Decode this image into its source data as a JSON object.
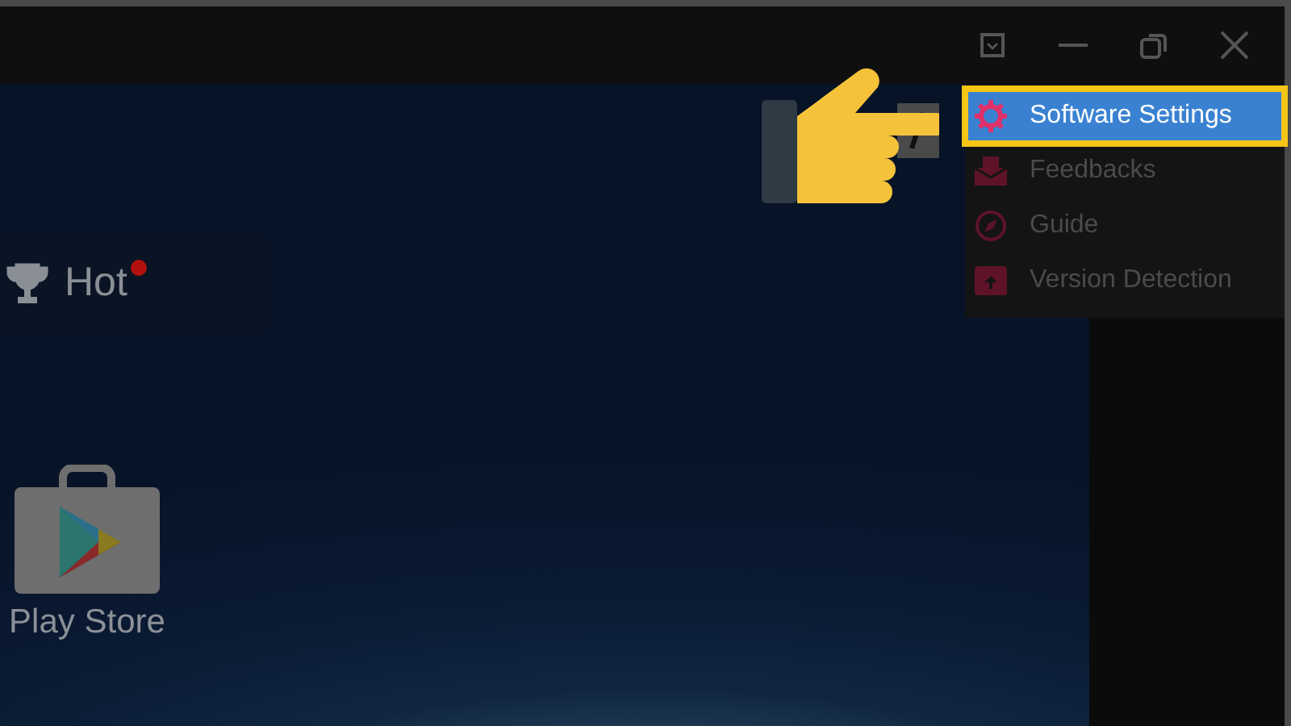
{
  "home_screen": {
    "hot_tab": {
      "label": "Hot",
      "notification": true
    },
    "apps": [
      {
        "label": "Play Store"
      }
    ]
  },
  "menu": {
    "items": [
      {
        "label": "Software Settings",
        "selected": true
      },
      {
        "label": "Feedbacks",
        "selected": false
      },
      {
        "label": "Guide",
        "selected": false
      },
      {
        "label": "Version Detection",
        "selected": false
      }
    ]
  }
}
